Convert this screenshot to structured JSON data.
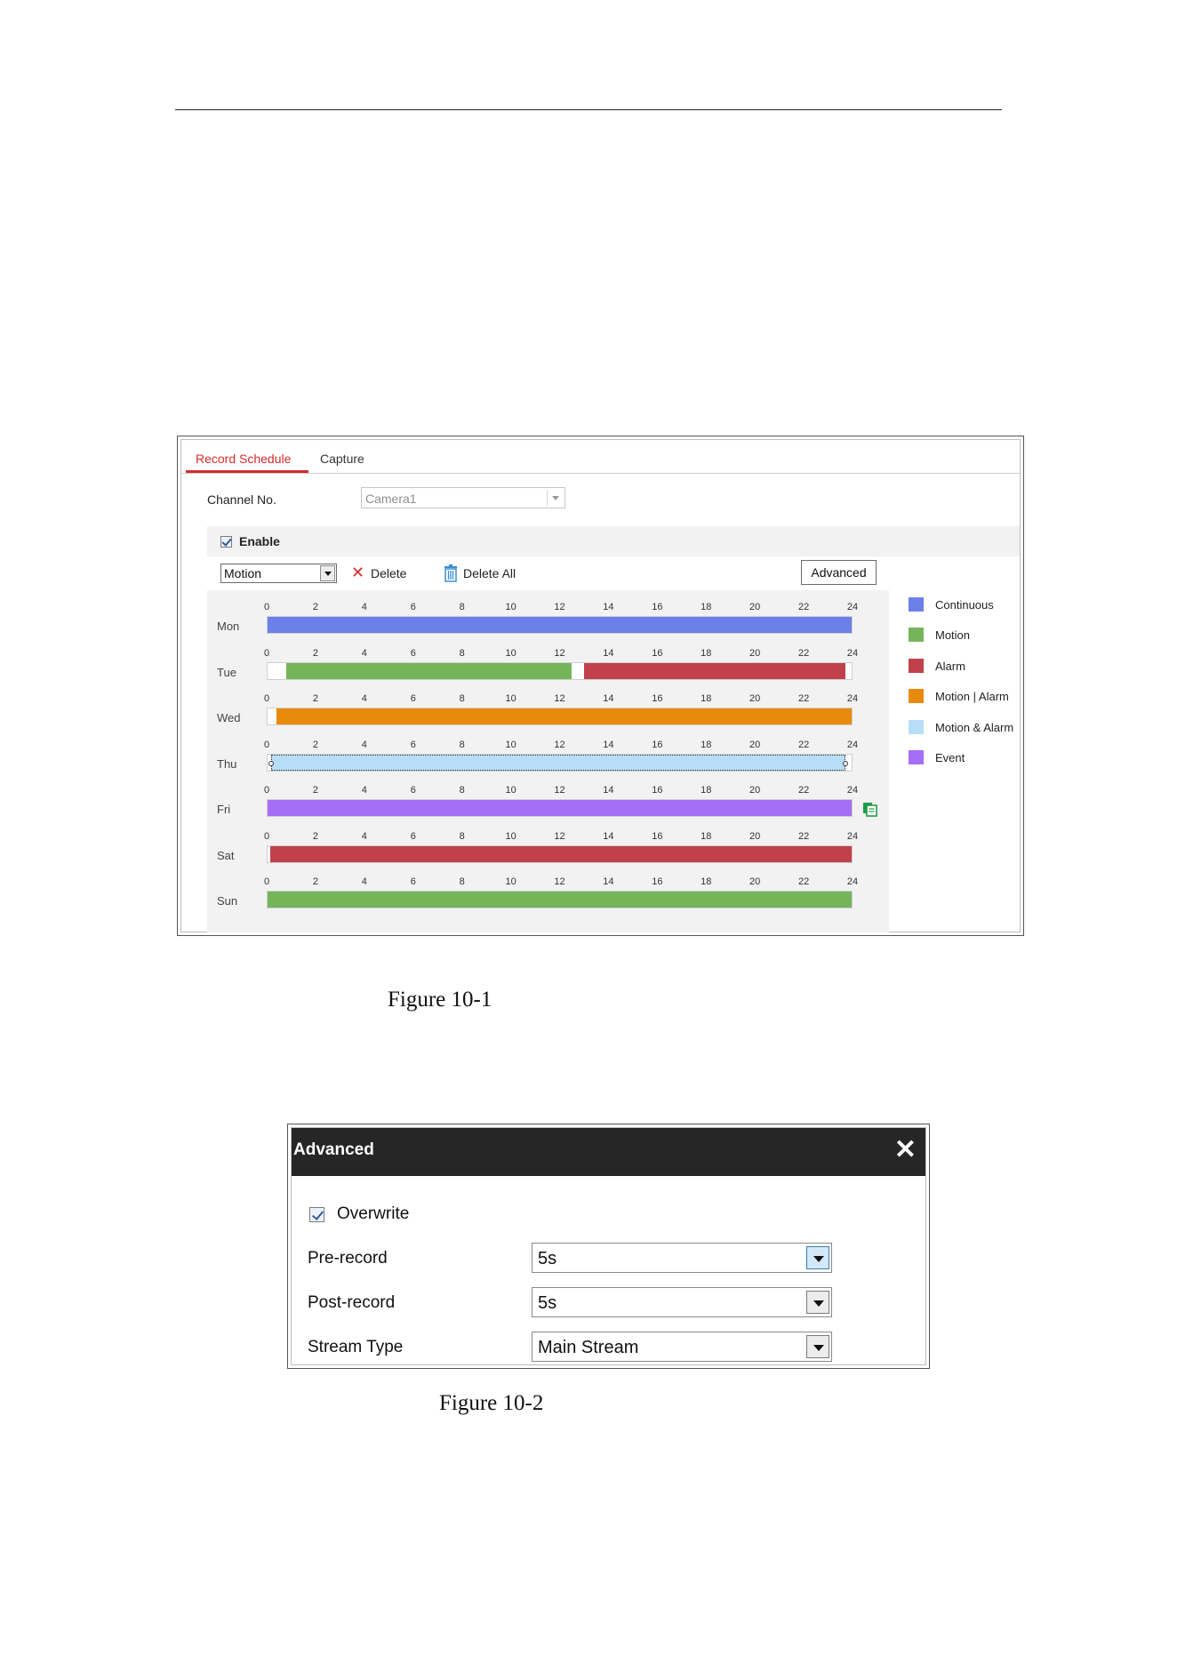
{
  "figure1": {
    "tabs": [
      {
        "label": "Record Schedule",
        "active": true
      },
      {
        "label": "Capture",
        "active": false
      }
    ],
    "channel": {
      "label": "Channel No.",
      "value": "Camera1"
    },
    "enable": {
      "label": "Enable",
      "checked": true
    },
    "toolbar": {
      "record_type": "Motion",
      "delete_label": "Delete",
      "delete_all_label": "Delete All",
      "advanced_label": "Advanced"
    },
    "hour_ticks": [
      "0",
      "2",
      "4",
      "6",
      "8",
      "10",
      "12",
      "14",
      "16",
      "18",
      "20",
      "22",
      "24"
    ],
    "legend": [
      {
        "label": "Continuous",
        "color": "#6b80e8"
      },
      {
        "label": "Motion",
        "color": "#74b55a"
      },
      {
        "label": "Alarm",
        "color": "#c0414a"
      },
      {
        "label": "Motion | Alarm",
        "color": "#e88a0c"
      },
      {
        "label": "Motion & Alarm",
        "color": "#b7def6"
      },
      {
        "label": "Event",
        "color": "#a66ef5"
      }
    ],
    "days": [
      {
        "label": "Mon",
        "segments": [
          {
            "type": "Continuous",
            "start": 0,
            "end": 24
          }
        ]
      },
      {
        "label": "Tue",
        "segments": [
          {
            "type": "Motion",
            "start": 0.75,
            "end": 12.5
          },
          {
            "type": "Alarm",
            "start": 13,
            "end": 23.75
          }
        ]
      },
      {
        "label": "Wed",
        "segments": [
          {
            "type": "Motion | Alarm",
            "start": 0.35,
            "end": 24
          }
        ]
      },
      {
        "label": "Thu",
        "segments": [
          {
            "type": "Motion & Alarm",
            "start": 0.15,
            "end": 23.75,
            "selected": true
          }
        ]
      },
      {
        "label": "Fri",
        "segments": [
          {
            "type": "Event",
            "start": 0,
            "end": 24
          }
        ],
        "copy_icon": true
      },
      {
        "label": "Sat",
        "segments": [
          {
            "type": "Alarm",
            "start": 0.1,
            "end": 24
          }
        ]
      },
      {
        "label": "Sun",
        "segments": [
          {
            "type": "Motion",
            "start": 0,
            "end": 24
          }
        ]
      }
    ],
    "caption": "Figure 10-1"
  },
  "figure2": {
    "title": "Advanced",
    "close_icon": "close-icon",
    "overwrite": {
      "label": "Overwrite",
      "checked": true
    },
    "fields": [
      {
        "label": "Pre-record",
        "value": "5s",
        "focused": true
      },
      {
        "label": "Post-record",
        "value": "5s",
        "focused": false
      },
      {
        "label": "Stream Type",
        "value": "Main Stream",
        "focused": false
      }
    ],
    "caption": "Figure 10-2"
  }
}
